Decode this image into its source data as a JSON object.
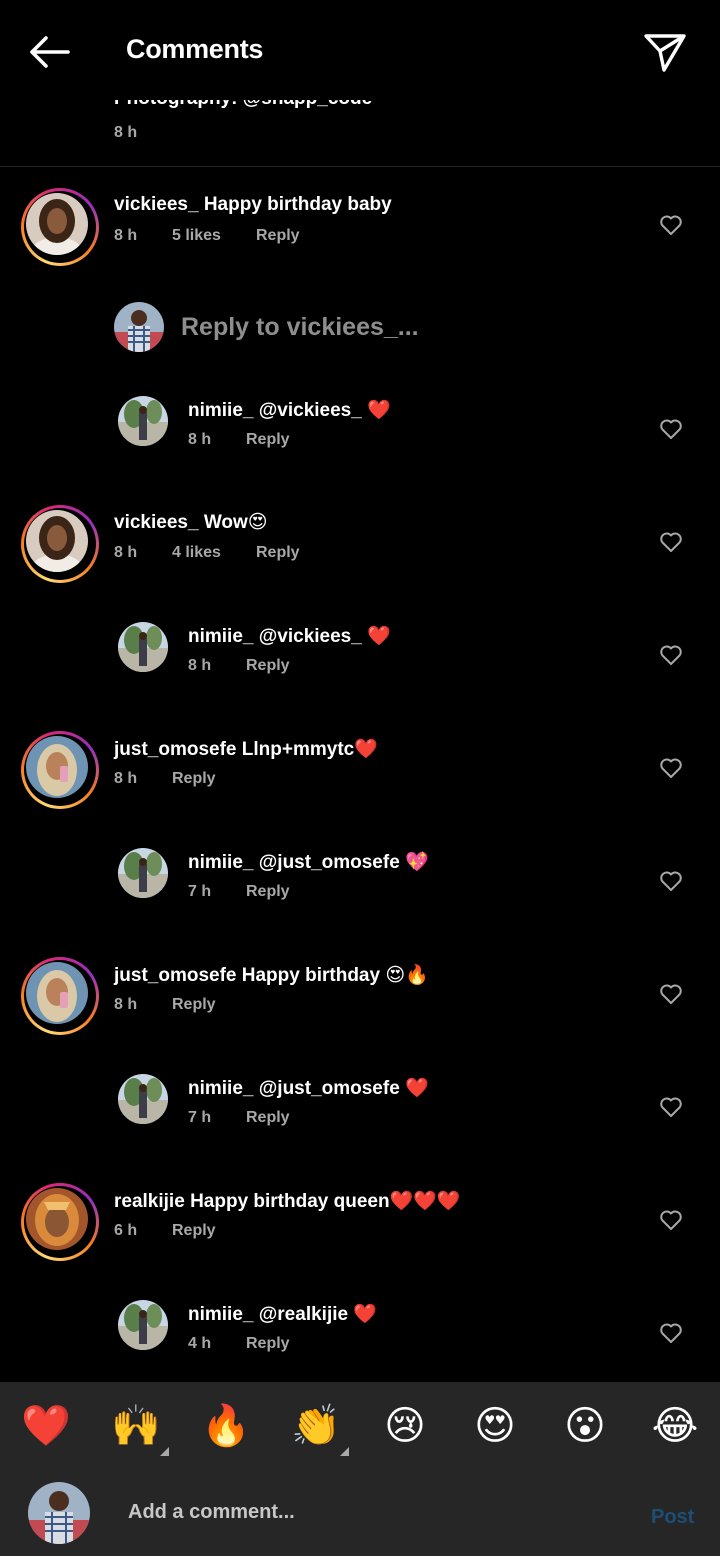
{
  "header": {
    "title": "Comments",
    "back_icon": "arrow-left-icon",
    "send_icon": "paper-plane-icon"
  },
  "caption": {
    "text": "Photography: @snapp_code",
    "time": "8 h"
  },
  "comments": [
    {
      "user": "vickiees_",
      "text": "Happy birthday baby",
      "time": "8 h",
      "likes": "5 likes",
      "reply": "Reply",
      "avatar": "vickiees"
    },
    {
      "user": "nimiie_",
      "text": "@vickiees_ ❤️",
      "time": "8 h",
      "reply": "Reply",
      "avatar": "nimiie",
      "is_reply": true
    },
    {
      "user": "vickiees_",
      "text": "Wow😍",
      "time": "8 h",
      "likes": "4 likes",
      "reply": "Reply",
      "avatar": "vickiees"
    },
    {
      "user": "nimiie_",
      "text": "@vickiees_ ❤️",
      "time": "8 h",
      "reply": "Reply",
      "avatar": "nimiie",
      "is_reply": true
    },
    {
      "user": "just_omosefe",
      "text": "Llnp+mmytc❤️",
      "time": "8 h",
      "reply": "Reply",
      "avatar": "omosefe"
    },
    {
      "user": "nimiie_",
      "text": "@just_omosefe 💖",
      "time": "7 h",
      "reply": "Reply",
      "avatar": "nimiie",
      "is_reply": true
    },
    {
      "user": "just_omosefe",
      "text": "Happy birthday 😍🔥",
      "time": "8 h",
      "reply": "Reply",
      "avatar": "omosefe"
    },
    {
      "user": "nimiie_",
      "text": "@just_omosefe ❤️",
      "time": "7 h",
      "reply": "Reply",
      "avatar": "nimiie",
      "is_reply": true
    },
    {
      "user": "realkijie",
      "text": "Happy birthday queen❤️❤️❤️",
      "time": "6 h",
      "reply": "Reply",
      "avatar": "realkijie"
    },
    {
      "user": "nimiie_",
      "text": "@realkijie ❤️",
      "time": "4 h",
      "reply": "Reply",
      "avatar": "nimiie",
      "is_reply": true
    }
  ],
  "reply_prompt": {
    "text": "Reply to vickiees_..."
  },
  "emoji_bar": {
    "emojis": [
      "❤️",
      "🙌",
      "🔥",
      "👏",
      "😢",
      "😍",
      "😮",
      "😂"
    ]
  },
  "comment_bar": {
    "placeholder": "Add a comment...",
    "post_label": "Post"
  },
  "colors": {
    "background": "#000000",
    "bar": "#262626",
    "muted": "#a8a8a8",
    "post": "#1d4e78"
  }
}
